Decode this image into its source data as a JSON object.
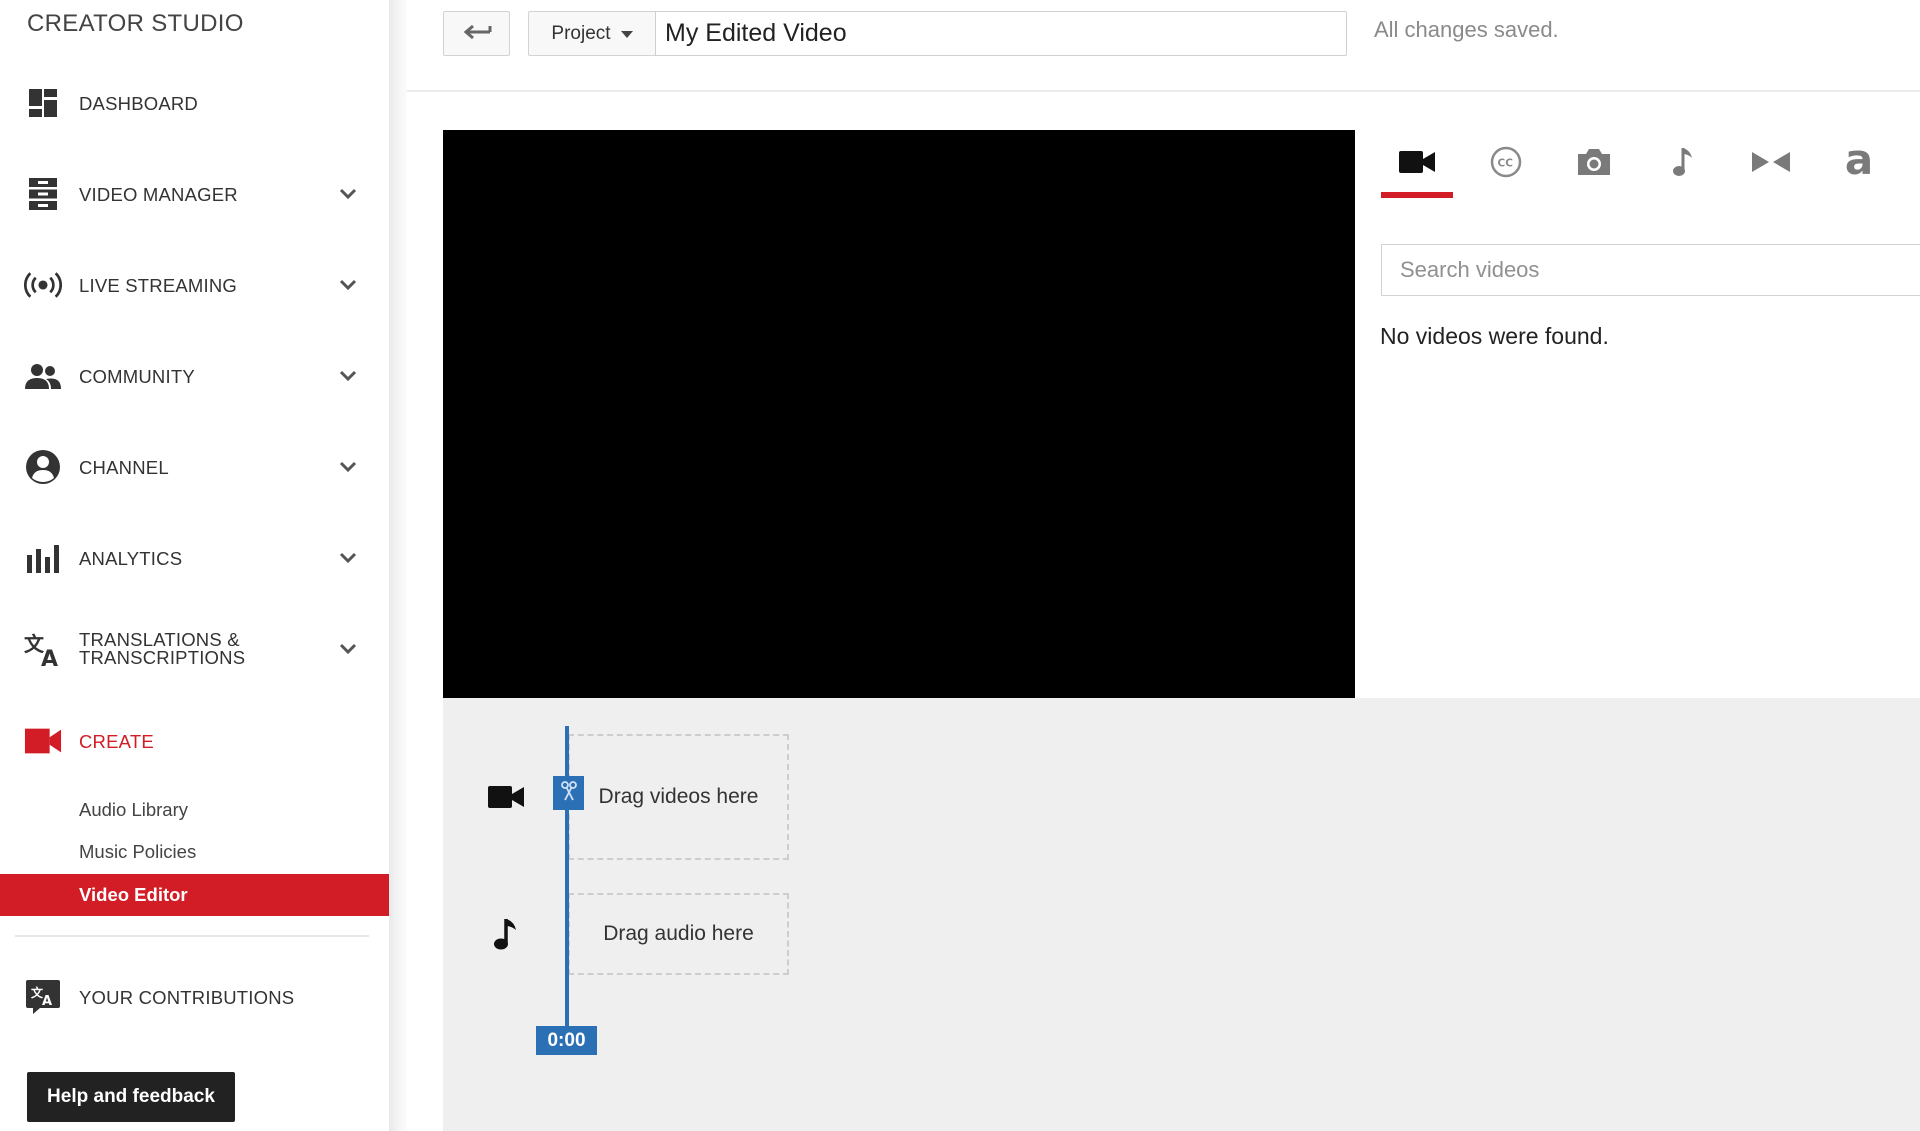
{
  "sidebar": {
    "brand": "CREATOR STUDIO",
    "items": [
      {
        "label": "DASHBOARD"
      },
      {
        "label": "VIDEO MANAGER"
      },
      {
        "label": "LIVE STREAMING"
      },
      {
        "label": "COMMUNITY"
      },
      {
        "label": "CHANNEL"
      },
      {
        "label": "ANALYTICS"
      },
      {
        "label_line1": "TRANSLATIONS &",
        "label_line2": "TRANSCRIPTIONS"
      },
      {
        "label": "CREATE"
      }
    ],
    "create_subitems": [
      {
        "label": "Audio Library"
      },
      {
        "label": "Music Policies"
      },
      {
        "label": "Video Editor",
        "active": true
      }
    ],
    "contributions": "YOUR CONTRIBUTIONS",
    "help": "Help and feedback"
  },
  "toolbar": {
    "project_label": "Project",
    "title_value": "My Edited Video",
    "save_status": "All changes saved."
  },
  "panel": {
    "tabs": [
      {
        "icon": "video-camera-icon",
        "active": true
      },
      {
        "icon": "closed-captions-icon"
      },
      {
        "icon": "photo-camera-icon"
      },
      {
        "icon": "music-note-icon"
      },
      {
        "icon": "transitions-icon"
      },
      {
        "icon": "text-icon",
        "glyph": "a"
      }
    ],
    "search_placeholder": "Search videos",
    "no_results": "No videos were found."
  },
  "timeline": {
    "video_drop": "Drag videos here",
    "audio_drop": "Drag audio here",
    "time": "0:00"
  },
  "colors": {
    "accent_red": "#d21c26",
    "playhead_blue": "#2b6fb5",
    "timeline_bg": "#efefef"
  }
}
